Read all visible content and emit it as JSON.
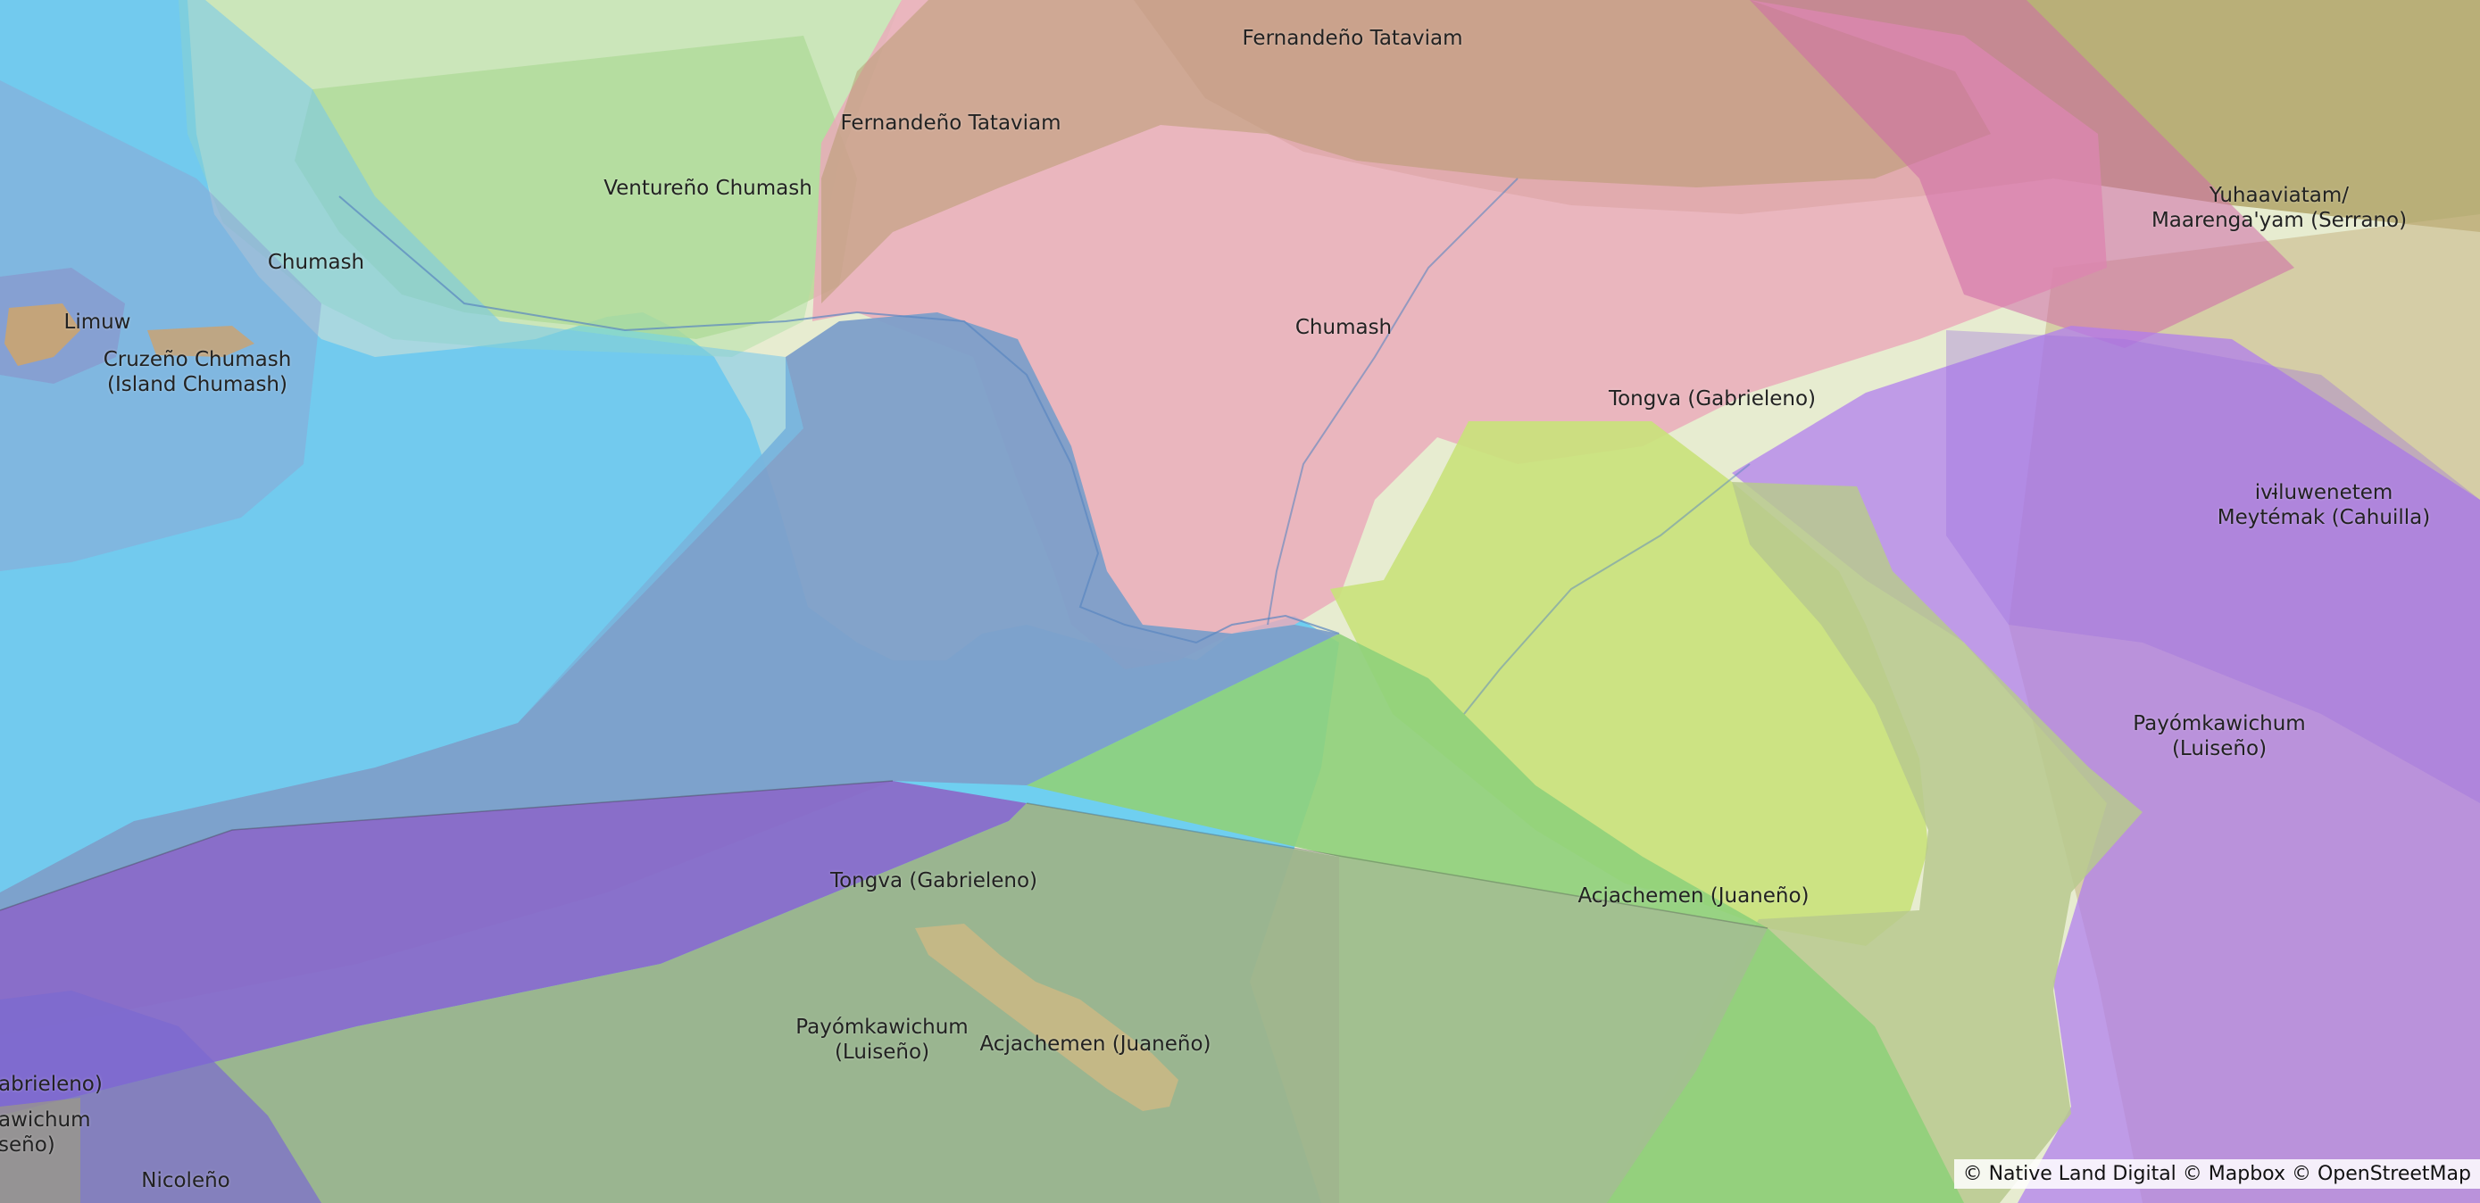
{
  "map": {
    "territories": [
      {
        "id": "t1",
        "label": "Fernandeño Tataviam"
      },
      {
        "id": "t2",
        "label": "Fernandeño Tataviam"
      },
      {
        "id": "t3",
        "label": "Ventureño Chumash"
      },
      {
        "id": "t4",
        "label": "Chumash"
      },
      {
        "id": "t5",
        "label": "Limuw"
      },
      {
        "id": "t6",
        "label": "Cruzeño Chumash\n(Island Chumash)"
      },
      {
        "id": "t7",
        "label": "Chumash"
      },
      {
        "id": "t8",
        "label": "Tongva (Gabrieleno)"
      },
      {
        "id": "t9",
        "label": "Yuhaaviatam/\nMaarenga'yam (Serrano)"
      },
      {
        "id": "t10",
        "label": "ivi̵luwenetem\nMeytémak (Cahuilla)"
      },
      {
        "id": "t11",
        "label": "Payómkawichum\n(Luiseño)"
      },
      {
        "id": "t12",
        "label": "Tongva (Gabrieleno)"
      },
      {
        "id": "t13",
        "label": "Acjachemen (Juaneño)"
      },
      {
        "id": "t14",
        "label": "Payómkawichum\n(Luiseño)"
      },
      {
        "id": "t15",
        "label": "Acjachemen (Juaneño)"
      },
      {
        "id": "t16",
        "label": "abrieleno)"
      },
      {
        "id": "t17",
        "label": "awichum\nseño)"
      },
      {
        "id": "t18",
        "label": "Nicoleño"
      }
    ],
    "colors": {
      "ocean": "#6fcff0",
      "land": "#e8ecd2",
      "mountains": "#a89a5c",
      "chumash_pink": "#eaaaba",
      "tongva_blue": "#7d9fc9",
      "luiseno_purple": "#b07cf0",
      "acjachemen_yellow": "#c9e27a",
      "green_coast": "#8fcf7a",
      "serrano_magenta": "#d06aa8",
      "dark_purple": "#8a6cc8",
      "olive": "#9cb38a"
    }
  },
  "attribution": {
    "text": "© Native Land Digital © Mapbox © OpenStreetMap"
  }
}
